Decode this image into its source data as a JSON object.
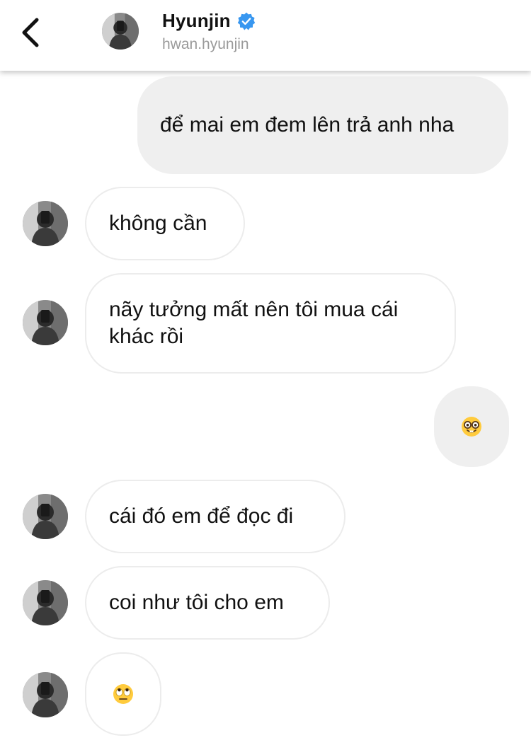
{
  "header": {
    "contact_name": "Hyunjin",
    "contact_handle": "hwan.hyunjin",
    "back_icon": "chevron-left-icon",
    "verified_icon": "verified-badge-icon",
    "verified_color": "#3897f0"
  },
  "messages": [
    {
      "sender": "me",
      "text": "để mai em đem lên trả anh nha"
    },
    {
      "sender": "them",
      "text": "không cần"
    },
    {
      "sender": "them",
      "text": "nãy tưởng mất nên tôi mua cái khác rồi"
    },
    {
      "sender": "me",
      "emoji": "nerd-face-emoji"
    },
    {
      "sender": "them",
      "text": "cái đó em để đọc đi"
    },
    {
      "sender": "them",
      "text": "coi như tôi cho em"
    },
    {
      "sender": "them",
      "emoji": "face-with-rolling-eyes-emoji"
    }
  ],
  "colors": {
    "my_bubble": "#efefef",
    "their_bubble_border": "#ececec",
    "handle_text": "#9a9a9a"
  }
}
